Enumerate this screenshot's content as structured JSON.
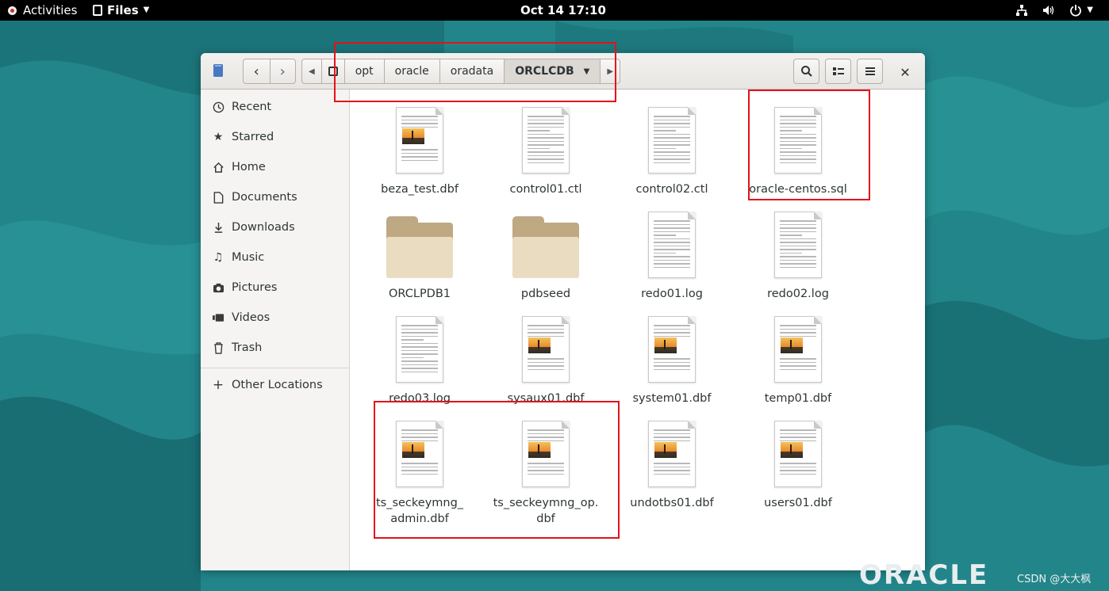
{
  "topbar": {
    "activities_label": "Activities",
    "app_menu_label": "Files",
    "clock": "Oct 14  17:10"
  },
  "window": {
    "nav_back_icon": "chevron-left-icon",
    "nav_forward_icon": "chevron-right-icon",
    "path": [
      "opt",
      "oracle",
      "oradata",
      "ORCLCDB"
    ],
    "close_glyph": "✕"
  },
  "sidebar": {
    "items": [
      {
        "label": "Recent",
        "icon": "clock-icon"
      },
      {
        "label": "Starred",
        "icon": "star-icon"
      },
      {
        "label": "Home",
        "icon": "home-icon"
      },
      {
        "label": "Documents",
        "icon": "document-icon"
      },
      {
        "label": "Downloads",
        "icon": "download-icon"
      },
      {
        "label": "Music",
        "icon": "music-icon"
      },
      {
        "label": "Pictures",
        "icon": "camera-icon"
      },
      {
        "label": "Videos",
        "icon": "video-icon"
      },
      {
        "label": "Trash",
        "icon": "trash-icon"
      }
    ],
    "other_locations": "Other Locations"
  },
  "files": [
    {
      "name": "beza_test.dbf",
      "kind": "image-doc"
    },
    {
      "name": "control01.ctl",
      "kind": "text-doc"
    },
    {
      "name": "control02.ctl",
      "kind": "text-doc"
    },
    {
      "name": "oracle-centos.sql",
      "kind": "text-doc"
    },
    {
      "name": "ORCLPDB1",
      "kind": "folder"
    },
    {
      "name": "pdbseed",
      "kind": "folder"
    },
    {
      "name": "redo01.log",
      "kind": "text-doc"
    },
    {
      "name": "redo02.log",
      "kind": "text-doc"
    },
    {
      "name": "redo03.log",
      "kind": "text-doc"
    },
    {
      "name": "sysaux01.dbf",
      "kind": "image-doc"
    },
    {
      "name": "system01.dbf",
      "kind": "image-doc"
    },
    {
      "name": "temp01.dbf",
      "kind": "image-doc"
    },
    {
      "name": "ts_seckeymng_\nadmin.dbf",
      "kind": "image-doc"
    },
    {
      "name": "ts_seckeymng_op.\ndbf",
      "kind": "image-doc"
    },
    {
      "name": "undotbs01.dbf",
      "kind": "image-doc"
    },
    {
      "name": "users01.dbf",
      "kind": "image-doc"
    }
  ],
  "desktop": {
    "watermark": "CSDN @大大枫",
    "logo_text": "ORACLE"
  },
  "colors": {
    "highlight": "#e3121b",
    "wallpaper": "#1f7a80"
  }
}
